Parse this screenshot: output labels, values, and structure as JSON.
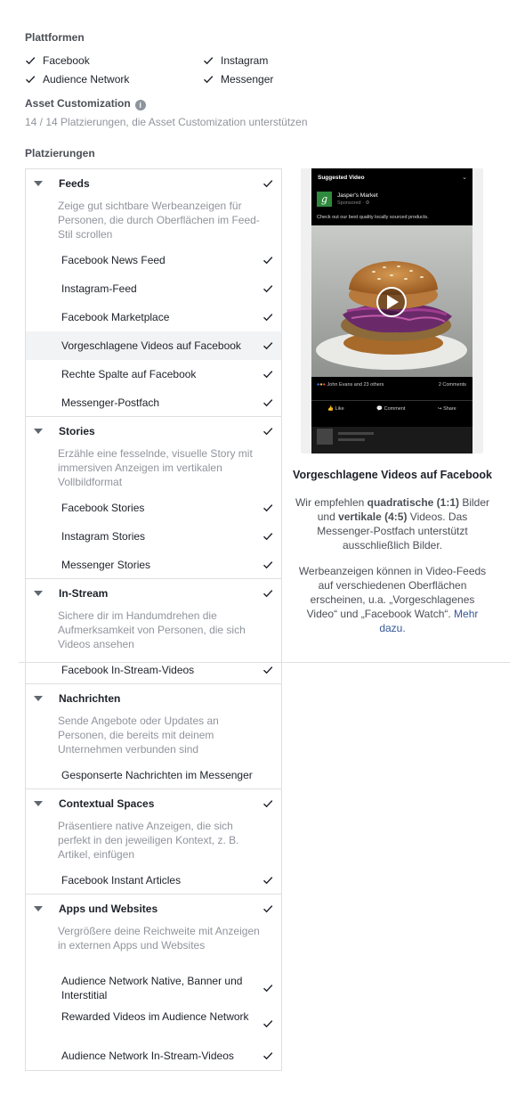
{
  "platforms": {
    "title": "Plattformen",
    "items": [
      {
        "label": "Facebook",
        "checked": true
      },
      {
        "label": "Instagram",
        "checked": true
      },
      {
        "label": "Audience Network",
        "checked": true
      },
      {
        "label": "Messenger",
        "checked": true
      }
    ]
  },
  "asset_customization": {
    "title": "Asset Customization",
    "info_icon": "info-icon",
    "text": "14 / 14 Platzierungen, die Asset Customization unterstützen"
  },
  "placements": {
    "title": "Platzierungen",
    "groups": [
      {
        "title": "Feeds",
        "description": "Zeige gut sichtbare Werbeanzeigen für Personen, die durch Oberflächen im Feed-Stil scrollen",
        "checked": true,
        "items": [
          {
            "label": "Facebook News Feed",
            "checked": true
          },
          {
            "label": "Instagram-Feed",
            "checked": true
          },
          {
            "label": "Facebook Marketplace",
            "checked": true
          },
          {
            "label": "Vorgeschlagene Videos auf Facebook",
            "checked": true,
            "highlighted": true
          },
          {
            "label": "Rechte Spalte auf Facebook",
            "checked": true
          },
          {
            "label": "Messenger-Postfach",
            "checked": true
          }
        ]
      },
      {
        "title": "Stories",
        "description": "Erzähle eine fesselnde, visuelle Story mit immersiven Anzeigen im vertikalen Vollbildformat",
        "checked": true,
        "items": [
          {
            "label": "Facebook Stories",
            "checked": true
          },
          {
            "label": "Instagram Stories",
            "checked": true
          },
          {
            "label": "Messenger Stories",
            "checked": true
          }
        ]
      },
      {
        "title": "In-Stream",
        "description": "Sichere dir im Handumdrehen die Aufmerksamkeit von Personen, die sich Videos ansehen",
        "checked": true,
        "items": [
          {
            "label": "Facebook In-Stream-Videos",
            "checked": true
          }
        ]
      },
      {
        "title": "Nachrichten",
        "description": "Sende Angebote oder Updates an Personen, die bereits mit deinem Unternehmen verbunden sind",
        "checked": false,
        "items": [
          {
            "label": "Gesponserte Nachrichten im Messenger",
            "checked": false
          }
        ]
      },
      {
        "title": "Contextual Spaces",
        "description": "Präsentiere native Anzeigen, die sich perfekt in den jeweiligen Kontext, z. B. Artikel, einfügen",
        "checked": true,
        "items": [
          {
            "label": "Facebook Instant Articles",
            "checked": true
          }
        ]
      },
      {
        "title": "Apps und Websites",
        "description": "Vergrößere deine Reichweite mit Anzeigen in externen Apps und Websites",
        "checked": true,
        "items": [
          {
            "label": "Audience Network Native, Banner und Interstitial",
            "checked": true
          },
          {
            "label": "Rewarded Videos im Audience Network",
            "checked": true
          },
          {
            "label": "Audience Network In-Stream-Videos",
            "checked": true
          }
        ]
      }
    ]
  },
  "preview": {
    "header": "Suggested Video",
    "brand": "Jasper's Market",
    "brand_initial": "g",
    "sponsored": "Sponsored · ⚙",
    "ad_text": "Check out our best quality locally sourced products.",
    "reactions": "John Evans and 23 others",
    "comments": "2 Comments",
    "actions": [
      "Like",
      "Comment",
      "Share"
    ],
    "title": "Vorgeschlagene Videos auf Facebook",
    "para1_a": "Wir empfehlen ",
    "para1_b": "quadratische (1:1)",
    "para1_c": " Bilder und ",
    "para1_d": "vertikale (4:5)",
    "para1_e": " Videos. Das Messenger-Postfach unterstützt ausschließlich Bilder.",
    "para2": "Werbeanzeigen können in Video-Feeds auf verschiedenen Oberflächen erscheinen, u.a. „Vorgeschlagenes Video“ und „Facebook Watch“.",
    "link": "Mehr dazu.",
    "colors": {
      "link": "#365899",
      "brand": "#2f8a3d"
    }
  }
}
